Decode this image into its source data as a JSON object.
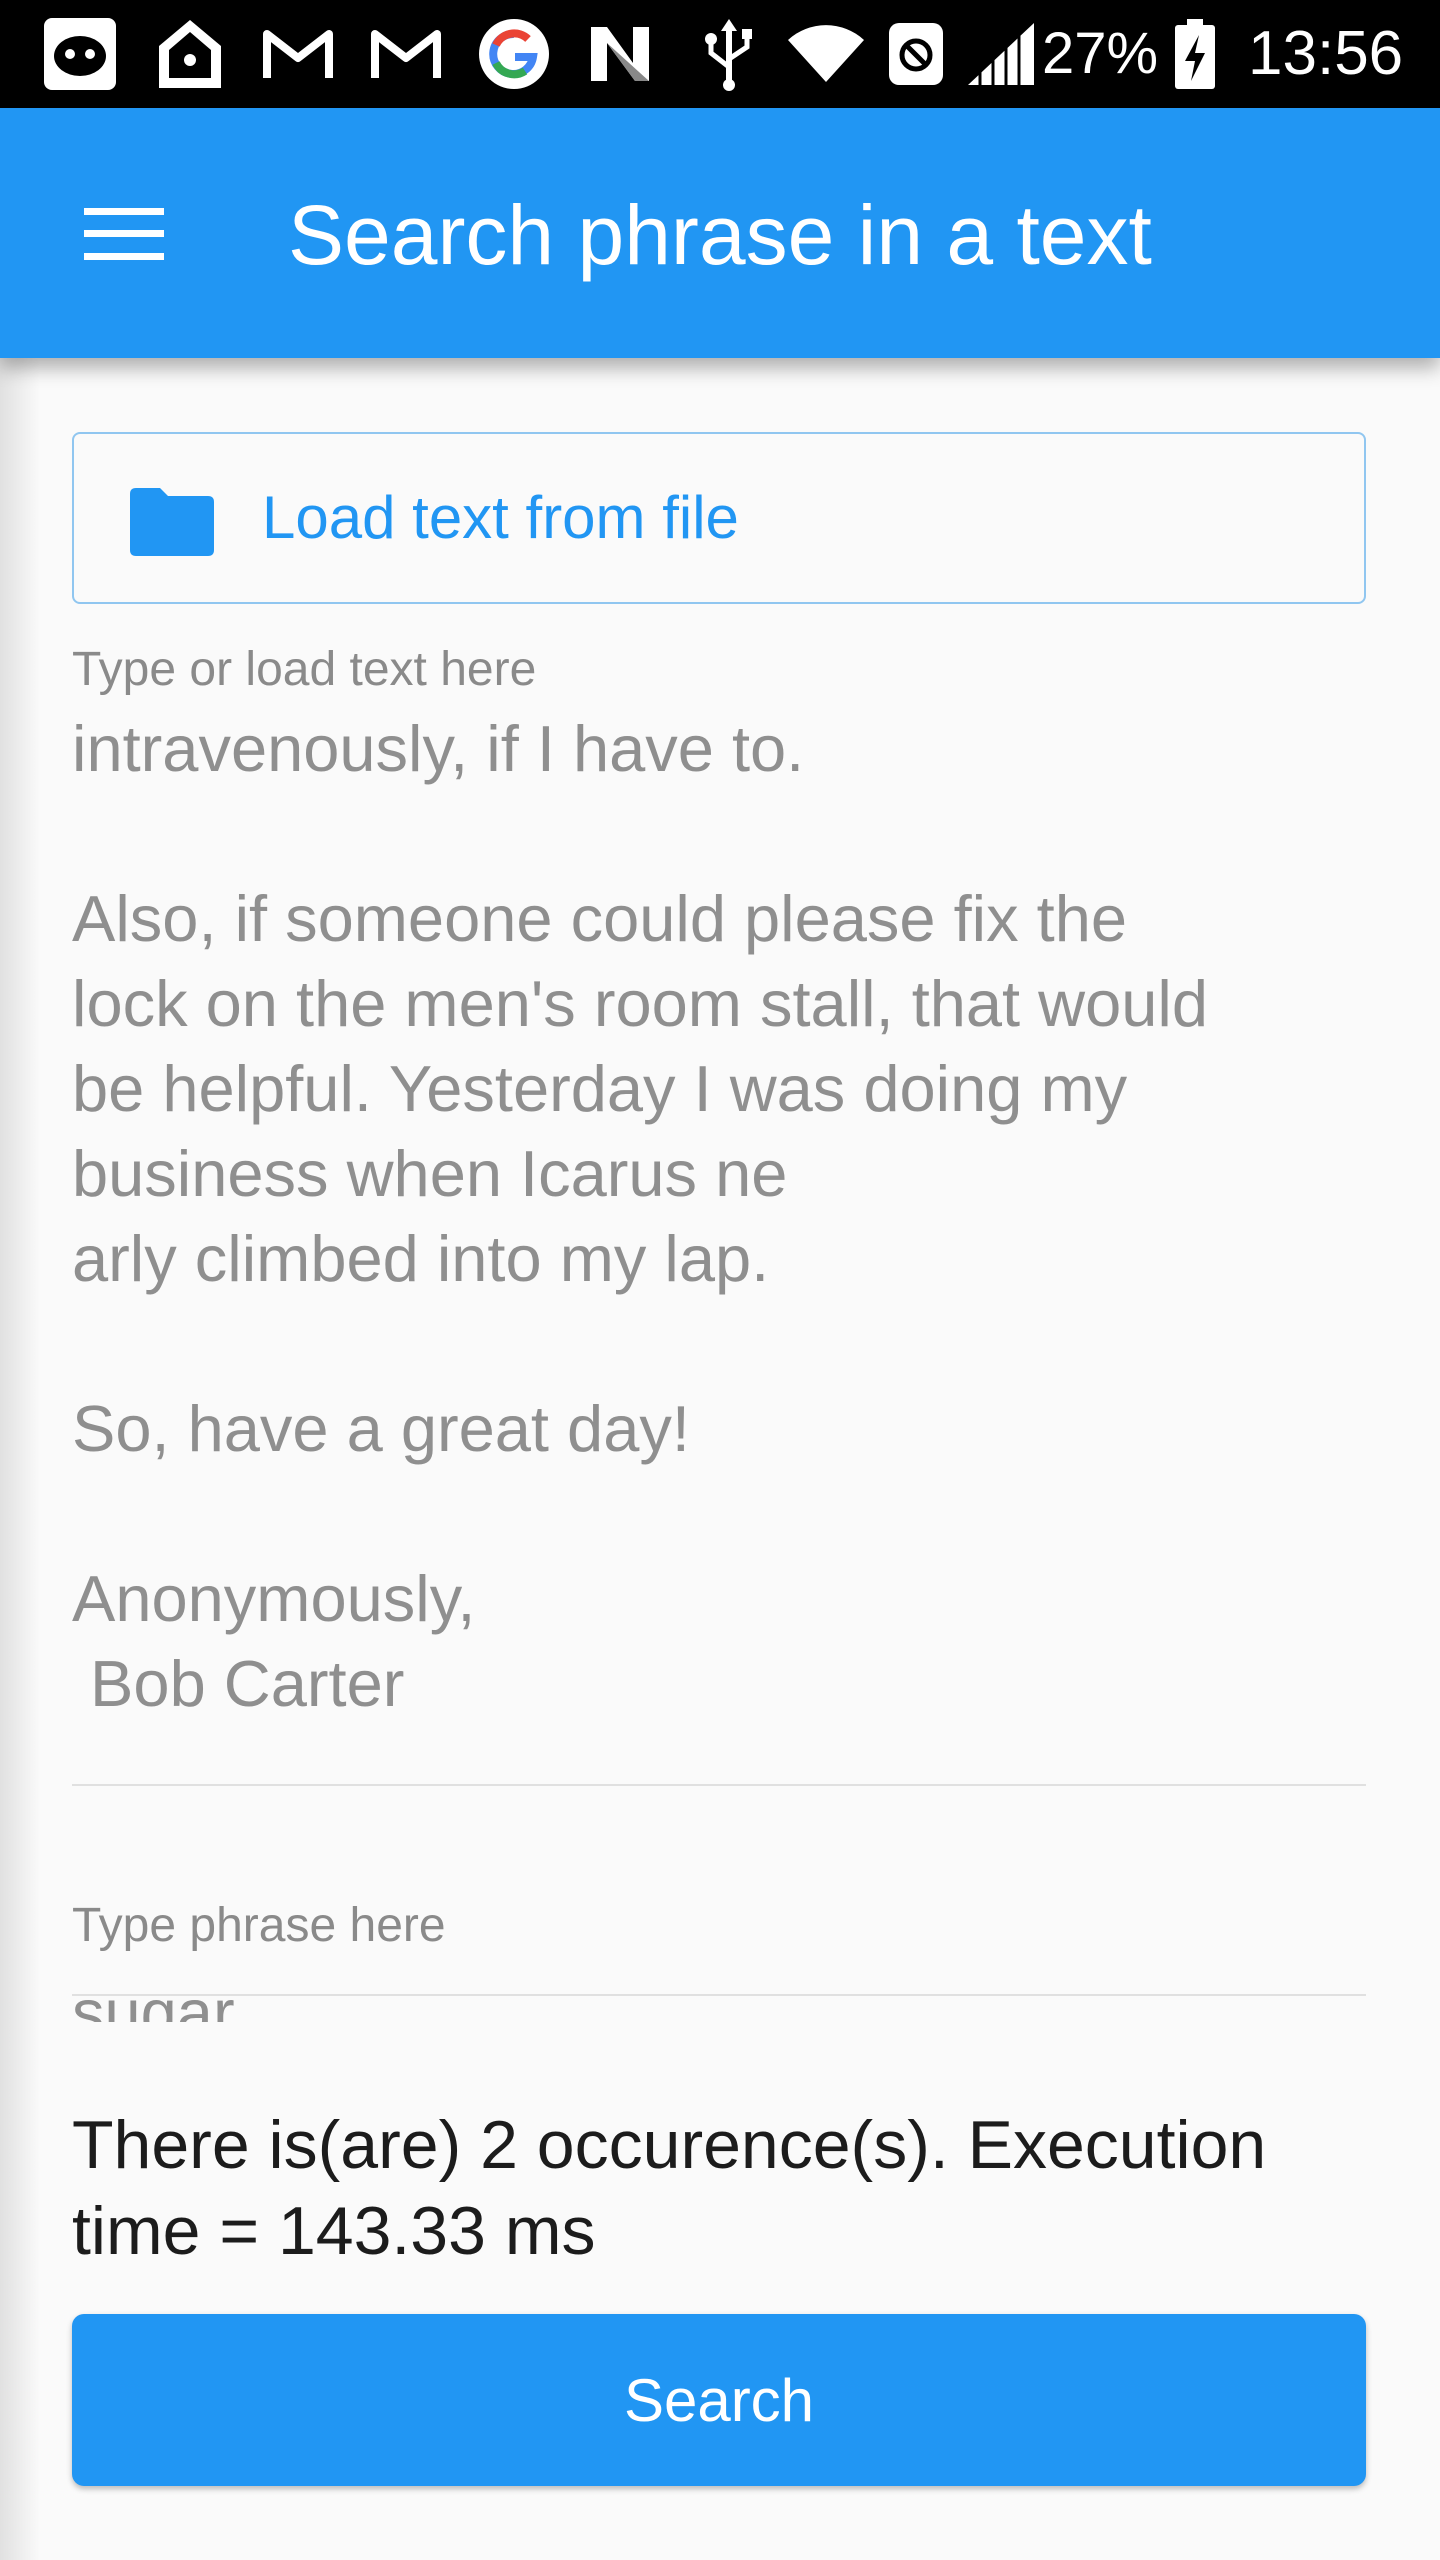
{
  "status_bar": {
    "battery": "27%",
    "time": "13:56",
    "icons": [
      "gamepad-app-icon",
      "home-app-icon",
      "gmail-icon",
      "gmail-icon",
      "google-icon",
      "n-app-icon",
      "usb-icon",
      "wifi-icon",
      "blocked-app-icon",
      "signal-icon",
      "battery-charging-icon"
    ]
  },
  "app_bar": {
    "title": "Search phrase in a text",
    "menu_icon": "hamburger-menu-icon"
  },
  "load_button": {
    "label": "Load text from file",
    "icon": "folder-icon"
  },
  "text_field": {
    "label": "Type or load text here",
    "value": "intravenously, if I have to.\n\nAlso, if someone could please fix the\nlock on the men's room stall, that would\nbe helpful. Yesterday I was doing my\nbusiness when Icarus ne\narly climbed into my lap.\n\nSo, have a great day!\n\nAnonymously,\n Bob Carter"
  },
  "phrase_field": {
    "label": "Type phrase here",
    "value": "sugar"
  },
  "result": {
    "text": "There is(are) 2 occurence(s). Execution time = 143.33 ms"
  },
  "search_button": {
    "label": "Search"
  },
  "colors": {
    "primary": "#2196f3",
    "background": "#fafafa",
    "muted_text": "#8f8f8f"
  }
}
